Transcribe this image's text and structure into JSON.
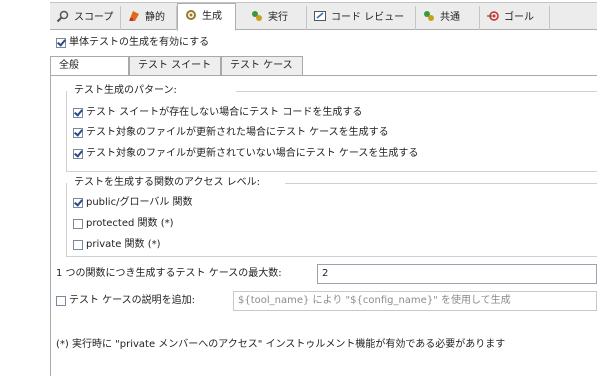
{
  "tabs": [
    {
      "label": "スコープ",
      "icon": "scope-icon",
      "active": false
    },
    {
      "label": "静的",
      "icon": "static-icon",
      "active": false
    },
    {
      "label": "生成",
      "icon": "generation-icon",
      "active": true
    },
    {
      "label": "実行",
      "icon": "execution-icon",
      "active": false
    },
    {
      "label": "コード レビュー",
      "icon": "code-review-icon",
      "active": false
    },
    {
      "label": "共通",
      "icon": "common-icon",
      "active": false
    },
    {
      "label": "ゴール",
      "icon": "goal-icon",
      "active": false
    }
  ],
  "enable_generation": {
    "label": "単体テストの生成を有効にする",
    "checked": true
  },
  "subtabs": [
    {
      "label": "全般",
      "active": true
    },
    {
      "label": "テスト スイート",
      "active": false
    },
    {
      "label": "テスト ケース",
      "active": false
    }
  ],
  "patterns": {
    "title": "テスト生成のパターン:",
    "items": [
      {
        "label": "テスト スイートが存在しない場合にテスト コードを生成する",
        "checked": true
      },
      {
        "label": "テスト対象のファイルが更新された場合にテスト ケースを生成する",
        "checked": true
      },
      {
        "label": "テスト対象のファイルが更新されていない場合にテスト ケースを生成する",
        "checked": true
      }
    ]
  },
  "access": {
    "title": "テストを生成する関数のアクセス レベル:",
    "items": [
      {
        "label": "public/グローバル 関数",
        "checked": true
      },
      {
        "label": "protected 関数 (*)",
        "checked": false
      },
      {
        "label": "private 関数 (*)",
        "checked": false
      }
    ]
  },
  "max_cases": {
    "label": "1 つの関数につき生成するテスト ケースの最大数:",
    "value": "2"
  },
  "description": {
    "label": "テスト ケースの説明を追加:",
    "checked": false,
    "value": "${tool_name} により \"${config_name}\" を使用して生成"
  },
  "footnote": "(*) 実行時に \"private メンバーへのアクセス\" インストゥルメント機能が有効である必要があります",
  "colors": {
    "active_tab_bg": "#ffffff",
    "tabbar_bg": "#ececec",
    "check_color": "#2b4a8a"
  }
}
